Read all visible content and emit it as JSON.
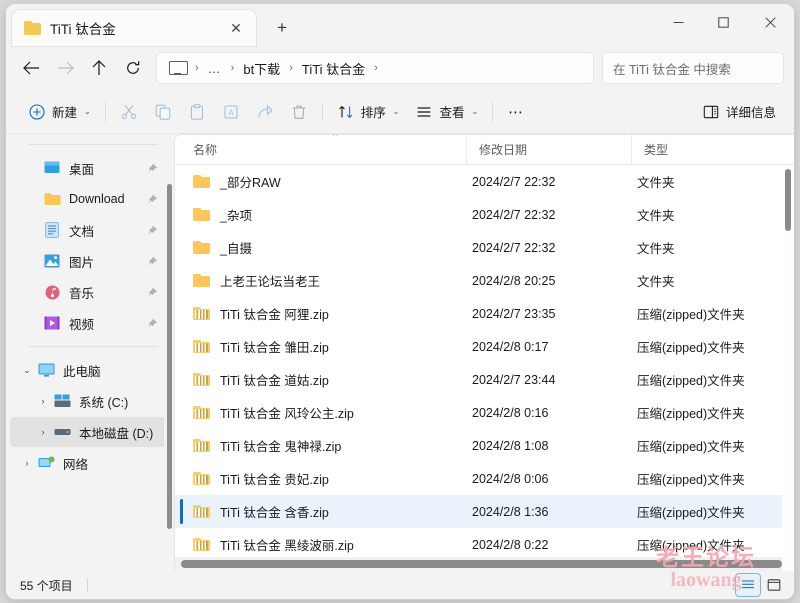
{
  "window": {
    "tab_title": "TiTi 钛合金",
    "tab_close": "✕",
    "new_tab": "+",
    "minimize": "—",
    "maximize": "▢",
    "close": "✕"
  },
  "nav": {
    "back": "←",
    "forward": "→",
    "up": "↑",
    "refresh": "⟳",
    "breadcrumbs": [
      {
        "label": "…",
        "sep": "›"
      },
      {
        "label": "bt下载",
        "sep": "›"
      },
      {
        "label": "TiTi 钛合金",
        "sep": "›"
      }
    ]
  },
  "search": {
    "placeholder": "在 TiTi 钛合金 中搜索"
  },
  "toolbar": {
    "new_label": "新建",
    "cut_label": "剪切",
    "copy_label": "复制",
    "paste_label": "粘贴",
    "rename_label": "重命名",
    "share_label": "共享",
    "delete_label": "删除",
    "sort_label": "排序",
    "view_label": "查看",
    "more_label": "⋯",
    "details_label": "详细信息",
    "caret": "⌄"
  },
  "sidebar": {
    "quick": [
      {
        "label": "桌面",
        "icon": "desktop-icon",
        "pinned": true
      },
      {
        "label": "Download",
        "icon": "folder-icon",
        "pinned": true
      },
      {
        "label": "文档",
        "icon": "document-icon",
        "pinned": true
      },
      {
        "label": "图片",
        "icon": "picture-icon",
        "pinned": true
      },
      {
        "label": "音乐",
        "icon": "music-icon",
        "pinned": true
      },
      {
        "label": "视频",
        "icon": "video-icon",
        "pinned": true
      }
    ],
    "tree": [
      {
        "label": "此电脑",
        "icon": "pc-icon",
        "chevron": "⌄",
        "indent": 0,
        "selected": false
      },
      {
        "label": "系统 (C:)",
        "icon": "sysdrive-icon",
        "chevron": "›",
        "indent": 1,
        "selected": false
      },
      {
        "label": "本地磁盘 (D:)",
        "icon": "drive-icon",
        "chevron": "›",
        "indent": 1,
        "selected": true
      },
      {
        "label": "网络",
        "icon": "network-icon",
        "chevron": "›",
        "indent": 0,
        "selected": false
      }
    ]
  },
  "columns": {
    "name": "名称",
    "date": "修改日期",
    "type": "类型",
    "sort_caret": "^"
  },
  "files": [
    {
      "name": "_部分RAW",
      "date": "2024/2/7 22:32",
      "type": "文件夹",
      "icon": "folder-icon",
      "selected": false
    },
    {
      "name": "_杂项",
      "date": "2024/2/7 22:32",
      "type": "文件夹",
      "icon": "folder-icon",
      "selected": false
    },
    {
      "name": "_自摄",
      "date": "2024/2/7 22:32",
      "type": "文件夹",
      "icon": "folder-icon",
      "selected": false
    },
    {
      "name": "上老王论坛当老王",
      "date": "2024/2/8 20:25",
      "type": "文件夹",
      "icon": "folder-icon",
      "selected": false
    },
    {
      "name": "TiTi 钛合金 阿狸.zip",
      "date": "2024/2/7 23:35",
      "type": "压缩(zipped)文件夹",
      "icon": "zip-icon",
      "selected": false
    },
    {
      "name": "TiTi 钛合金 雏田.zip",
      "date": "2024/2/8 0:17",
      "type": "压缩(zipped)文件夹",
      "icon": "zip-icon",
      "selected": false
    },
    {
      "name": "TiTi 钛合金 道姑.zip",
      "date": "2024/2/7 23:44",
      "type": "压缩(zipped)文件夹",
      "icon": "zip-icon",
      "selected": false
    },
    {
      "name": "TiTi 钛合金 风玲公主.zip",
      "date": "2024/2/8 0:16",
      "type": "压缩(zipped)文件夹",
      "icon": "zip-icon",
      "selected": false
    },
    {
      "name": "TiTi 钛合金 鬼神禄.zip",
      "date": "2024/2/8 1:08",
      "type": "压缩(zipped)文件夹",
      "icon": "zip-icon",
      "selected": false
    },
    {
      "name": "TiTi 钛合金 贵妃.zip",
      "date": "2024/2/8 0:06",
      "type": "压缩(zipped)文件夹",
      "icon": "zip-icon",
      "selected": false
    },
    {
      "name": "TiTi 钛合金 含香.zip",
      "date": "2024/2/8 1:36",
      "type": "压缩(zipped)文件夹",
      "icon": "zip-icon",
      "selected": true
    },
    {
      "name": "TiTi 钛合金 黑绫波丽.zip",
      "date": "2024/2/8 0:22",
      "type": "压缩(zipped)文件夹",
      "icon": "zip-icon",
      "selected": false
    }
  ],
  "status": {
    "item_count": "55 个项目"
  },
  "watermark": {
    "line1": "老王论坛",
    "line2": "laowang"
  },
  "colors": {
    "accent": "#0d6ebe",
    "selection_bg": "#eaf3fc",
    "folder": "#fcc75a",
    "watermark": "#f0a8b4"
  }
}
